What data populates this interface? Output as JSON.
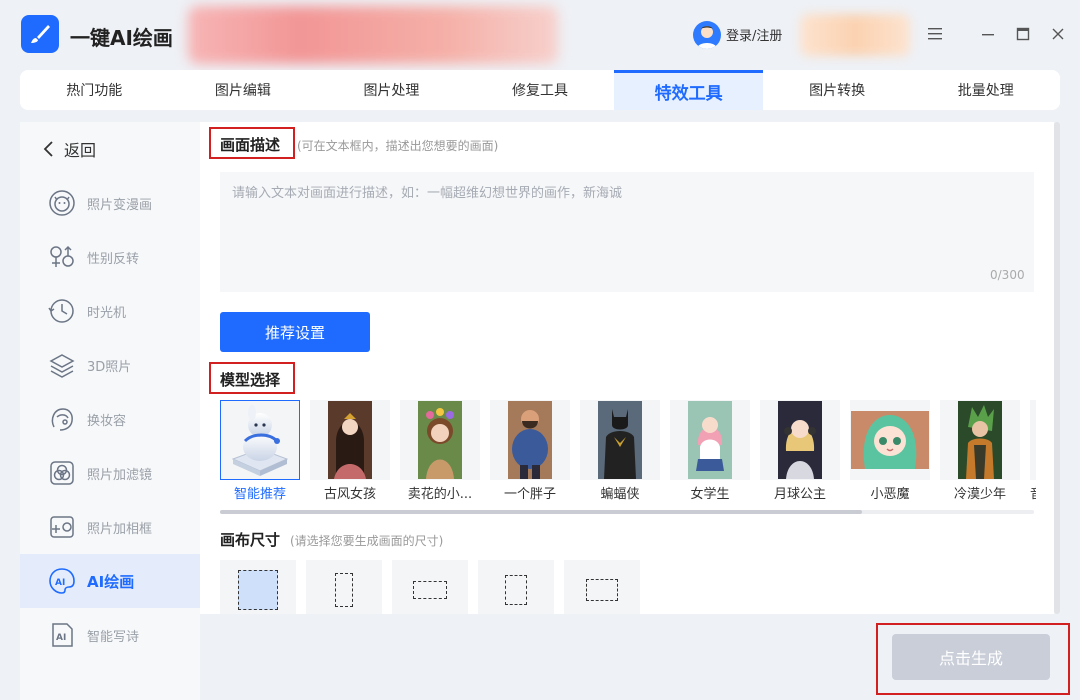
{
  "app": {
    "title": "一键AI绘画"
  },
  "header": {
    "login_label": "登录/注册"
  },
  "tabs": [
    {
      "label": "热门功能"
    },
    {
      "label": "图片编辑"
    },
    {
      "label": "图片处理"
    },
    {
      "label": "修复工具"
    },
    {
      "label": "特效工具",
      "active": true
    },
    {
      "label": "图片转换"
    },
    {
      "label": "批量处理"
    }
  ],
  "sidebar": {
    "back_label": "返回",
    "items": [
      {
        "label": "照片变漫画",
        "icon": "cartoon-face-icon"
      },
      {
        "label": "性别反转",
        "icon": "gender-icon"
      },
      {
        "label": "时光机",
        "icon": "clock-icon"
      },
      {
        "label": "3D照片",
        "icon": "layers-icon"
      },
      {
        "label": "换妆容",
        "icon": "makeup-icon"
      },
      {
        "label": "照片加滤镜",
        "icon": "filter-icon"
      },
      {
        "label": "照片加相框",
        "icon": "frame-icon"
      },
      {
        "label": "AI绘画",
        "icon": "ai-paint-icon",
        "active": true
      },
      {
        "label": "智能写诗",
        "icon": "ai-poem-icon"
      }
    ]
  },
  "description": {
    "title": "画面描述",
    "hint": "(可在文本框内，描述出您想要的画面)",
    "placeholder": "请输入文本对画面进行描述，如：一幅超维幻想世界的画作，新海诚",
    "value": "",
    "counter": "0/300"
  },
  "recommend_button": "推荐设置",
  "model": {
    "title": "模型选择",
    "items": [
      {
        "label": "智能推荐",
        "active": true
      },
      {
        "label": "古风女孩"
      },
      {
        "label": "卖花的小..."
      },
      {
        "label": "一个胖子"
      },
      {
        "label": "蝙蝠侠"
      },
      {
        "label": "女学生"
      },
      {
        "label": "月球公主"
      },
      {
        "label": "小恶魔"
      },
      {
        "label": "冷漠少年"
      },
      {
        "label": "音"
      }
    ]
  },
  "canvas_size": {
    "title": "画布尺寸",
    "hint": "(请选择您要生成画面的尺寸)"
  },
  "generate_button": "点击生成",
  "colors": {
    "accent": "#1f6bff",
    "highlight_box": "#d21f1f",
    "disabled": "#c9ced8"
  }
}
